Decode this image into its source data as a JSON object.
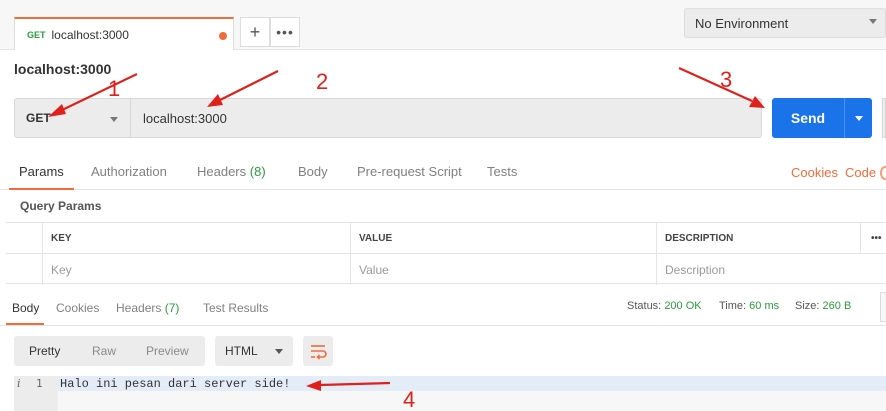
{
  "tabs": [
    {
      "method": "GET",
      "title": "localhost:3000",
      "method_color": "#2a9d3e",
      "unsaved_dot_color": "#f26b3a"
    }
  ],
  "tab_actions": {
    "add": "+",
    "more": "•••"
  },
  "environment": {
    "label": "No Environment"
  },
  "request": {
    "name": "localhost:3000",
    "method": "GET",
    "url": "localhost:3000",
    "send_label": "Send",
    "send_color": "#1a73e8"
  },
  "request_tabs": {
    "params": "Params",
    "authorization": "Authorization",
    "headers": "Headers",
    "headers_count": "(8)",
    "body": "Body",
    "pre_request": "Pre-request Script",
    "tests": "Tests",
    "cookies": "Cookies",
    "code": "Code",
    "accent_color": "#f26b3a"
  },
  "query_params": {
    "label": "Query Params",
    "columns": {
      "key": "KEY",
      "value": "VALUE",
      "description": "DESCRIPTION",
      "more": "•••"
    },
    "placeholders": {
      "key": "Key",
      "value": "Value",
      "description": "Description"
    }
  },
  "response_tabs": {
    "body": "Body",
    "cookies": "Cookies",
    "headers": "Headers",
    "headers_count": "(7)",
    "test_results": "Test Results"
  },
  "response_status": {
    "status_label": "Status:",
    "status_value": "200 OK",
    "time_label": "Time:",
    "time_value": "60 ms",
    "size_label": "Size:",
    "size_value": "260 B",
    "ok_color": "#2a9d3e"
  },
  "response_toolbar": {
    "pretty": "Pretty",
    "raw": "Raw",
    "preview": "Preview",
    "language": "HTML",
    "wrap_icon": "wrap-lines-icon"
  },
  "response_body": {
    "info_icon": "i",
    "line_number": "1",
    "line_text": "Halo ini pesan dari server side!"
  },
  "annotations": {
    "labels": [
      "1",
      "2",
      "3",
      "4"
    ],
    "color": "#e0201b"
  }
}
